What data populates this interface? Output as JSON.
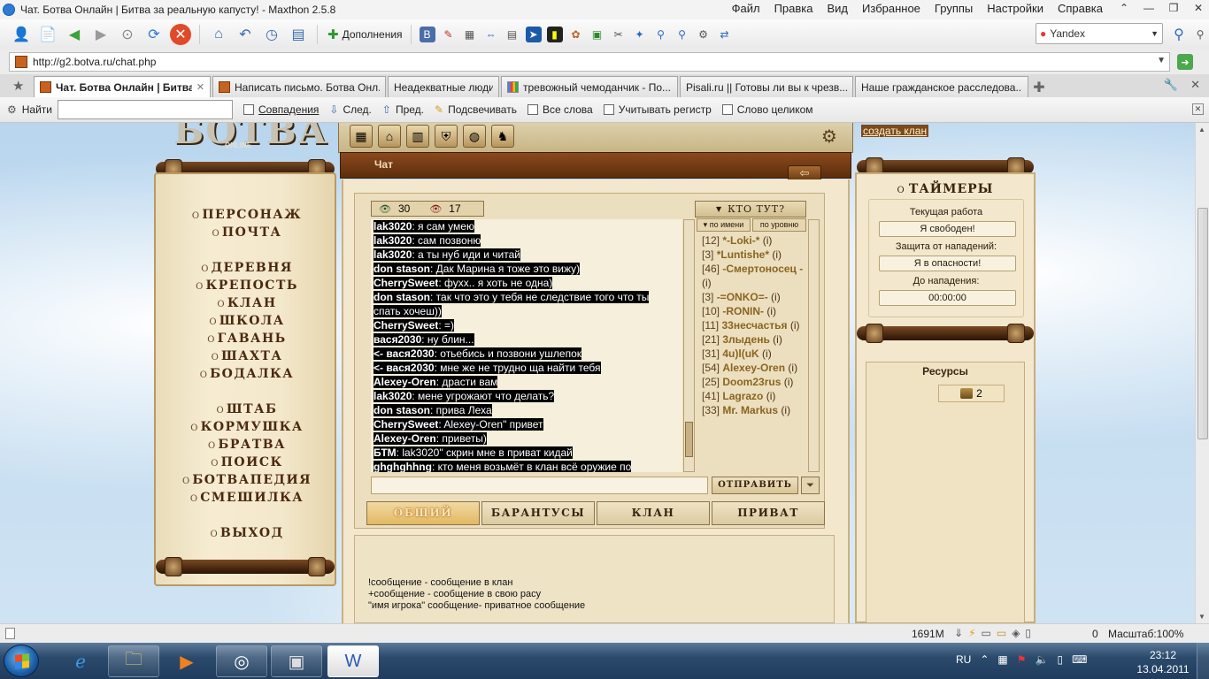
{
  "window": {
    "title": "Чат. Ботва Онлайн | Битва за реальную капусту! - Maxthon 2.5.8",
    "menu": [
      "Файл",
      "Правка",
      "Вид",
      "Избранное",
      "Группы",
      "Настройки",
      "Справка"
    ]
  },
  "toolbar": {
    "addons_label": "Дополнения",
    "search_engine": "Yandex"
  },
  "address": {
    "url": "http://g2.botva.ru/chat.php"
  },
  "tabs": [
    {
      "label": "Чат. Ботва Онлайн | Битва з...",
      "active": true,
      "icon": "botva-favicon"
    },
    {
      "label": "Написать письмо. Ботва Онл...",
      "active": false,
      "icon": "botva-favicon"
    },
    {
      "label": "Неадекватные люди",
      "active": false,
      "icon": ""
    },
    {
      "label": "тревожный чемоданчик - По...",
      "active": false,
      "icon": "google-favicon"
    },
    {
      "label": "Pisali.ru || Готовы ли вы к чрезв...",
      "active": false,
      "icon": ""
    },
    {
      "label": "Наше гражданское расследова...",
      "active": false,
      "icon": ""
    }
  ],
  "findbar": {
    "find_label": "Найти",
    "match_label": "Совпадения",
    "next_label": "След.",
    "prev_label": "Пред.",
    "highlight_label": "Подсвечивать",
    "all_words_label": "Все слова",
    "case_label": "Учитывать регистр",
    "whole_word_label": "Слово целиком"
  },
  "game": {
    "logo": "БОТВА",
    "logo_sub": "ONLINE",
    "create_clan": "создать клан",
    "chat_header": "Чат",
    "menu": [
      "Персонаж",
      "Почта",
      "Деревня",
      "Крепость",
      "Клан",
      "Школа",
      "Гавань",
      "Шахта",
      "Бодалка",
      "Штаб",
      "Кормушка",
      "Братва",
      "Поиск",
      "Ботвапедия",
      "Смешилка",
      "Выход"
    ],
    "counters": {
      "online": "30",
      "watching": "17"
    },
    "messages": [
      {
        "nick": "lak3020",
        "text": ": я сам умею"
      },
      {
        "nick": "lak3020",
        "text": ": сам позвоню"
      },
      {
        "nick": "lak3020",
        "text": ": а ты нуб иди и читай"
      },
      {
        "nick": "don stason",
        "text": ": Дак Марина я тоже это вижу)"
      },
      {
        "nick": "CherrySweet",
        "text": ": фухх.. я хоть не одна)"
      },
      {
        "nick": "don stason",
        "text": ": так что это у тебя не следствие того что ты"
      },
      {
        "nick": "",
        "text": "спать хочеш))"
      },
      {
        "nick": "CherrySweet",
        "text": ": =)"
      },
      {
        "nick": "вася2030",
        "text": ": ну блин..."
      },
      {
        "nick": "<- вася2030",
        "text": ": отьебись и позвони ушлепок"
      },
      {
        "nick": "<- вася2030",
        "text": ": мне же не трудно ща найти тебя"
      },
      {
        "nick": "Alexey-Oren",
        "text": ": драсти вам"
      },
      {
        "nick": "lak3020",
        "text": ": мене угрожают что делать?"
      },
      {
        "nick": "don stason",
        "text": ": прива Леха"
      },
      {
        "nick": "CherrySweet",
        "text": ": Alexey-Oren\" привет"
      },
      {
        "nick": "Alexey-Oren",
        "text": ": приветы)"
      },
      {
        "nick": "БТМ",
        "text": ": lak3020\" скрин мне в приват кидай"
      },
      {
        "nick": "ghghghhng",
        "text": ": кто меня возьмёт в клан всё оружие по"
      }
    ],
    "who_header": "КТО ТУТ?",
    "sort_by_name": "по имени",
    "sort_by_level": "по уровню",
    "users": [
      {
        "lvl": "[12]",
        "name": "*-Loki-*",
        "info": "(i)"
      },
      {
        "lvl": "[3]",
        "name": "*Luntishe*",
        "info": "(i)"
      },
      {
        "lvl": "[46]",
        "name": "-Смертоносец -",
        "info": "(i)"
      },
      {
        "lvl": "[3]",
        "name": "-=ONKO=-",
        "info": "(i)"
      },
      {
        "lvl": "[10]",
        "name": "-RONIN-",
        "info": "(i)"
      },
      {
        "lvl": "[11]",
        "name": "33несчастья",
        "info": "(i)"
      },
      {
        "lvl": "[21]",
        "name": "3лыдень",
        "info": "(i)"
      },
      {
        "lvl": "[31]",
        "name": "4u)l(uK",
        "info": "(i)"
      },
      {
        "lvl": "[54]",
        "name": "Alexey-Oren",
        "info": "(i)"
      },
      {
        "lvl": "[25]",
        "name": "Doom23rus",
        "info": "(i)"
      },
      {
        "lvl": "[41]",
        "name": "Lagrazo",
        "info": "(i)"
      },
      {
        "lvl": "[33]",
        "name": "Mr. Markus",
        "info": "(i)"
      }
    ],
    "send_label": "ОТПРАВИТЬ",
    "chat_tabs": [
      "Общий",
      "Барантусы",
      "Клан",
      "Приват"
    ],
    "help_lines": [
      "!сообщение - сообщение в клан",
      "+сообщение - сообщение в свою расу",
      "\"имя игрока\" сообщение- приватное сообщение"
    ],
    "timers": {
      "title": "Таймеры",
      "current_work_label": "Текущая работа",
      "current_work_value": "Я свободен!",
      "protection_label": "Защита от нападений:",
      "protection_value": "Я в опасности!",
      "until_attack_label": "До нападения:",
      "until_attack_value": "00:00:00"
    },
    "resources": {
      "title": "Ресурсы",
      "count": "2"
    }
  },
  "statusbar": {
    "memory": "1691M",
    "counter": "0",
    "zoom": "Масштаб:100%"
  },
  "taskbar": {
    "lang": "RU",
    "time": "23:12",
    "date": "13.04.2011"
  }
}
